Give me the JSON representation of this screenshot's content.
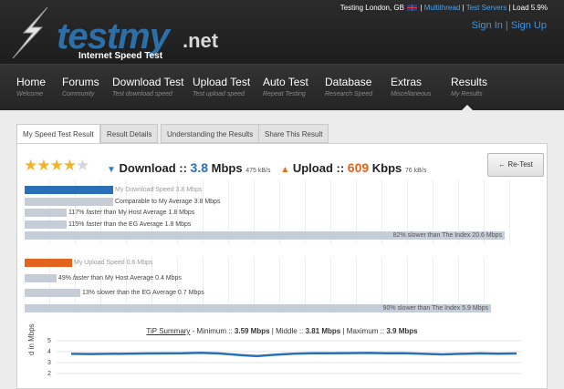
{
  "header": {
    "logo_text": "testmy",
    "logo_domain": ".net",
    "logo_subtitle": "Internet Speed Test",
    "top_status": {
      "location": "Testing London, GB",
      "link1": "Multithread",
      "link2": "Test Servers",
      "load": "Load 5.9%"
    },
    "sign_in": "Sign In",
    "sign_up": "Sign Up"
  },
  "nav": [
    {
      "label": "Home",
      "sub": "Welcome"
    },
    {
      "label": "Forums",
      "sub": "Community"
    },
    {
      "label": "Download Test",
      "sub": "Test download speed"
    },
    {
      "label": "Upload Test",
      "sub": "Test upload speed"
    },
    {
      "label": "Auto Test",
      "sub": "Repeat Testing"
    },
    {
      "label": "Database",
      "sub": "Research Speed"
    },
    {
      "label": "Extras",
      "sub": "Miscellaneous"
    },
    {
      "label": "Results",
      "sub": "My Results"
    }
  ],
  "tabs": [
    {
      "label": "My Speed Test Result"
    },
    {
      "label": "Result Details"
    },
    {
      "label": "Understanding the Results"
    },
    {
      "label": "Share This Result"
    }
  ],
  "rating": 4,
  "summary": {
    "download_label": "Download ::",
    "download_value": "3.8",
    "download_unit": "Mbps",
    "download_kb": "475 kB/s",
    "upload_label": "Upload ::",
    "upload_value": "609",
    "upload_unit": "Kbps",
    "upload_kb": "76 kB/s"
  },
  "retest_label": "← Re-Test",
  "download_bars": [
    {
      "label": "My Download Speed 3.8 Mbps",
      "pct": 18.5,
      "style": "blue"
    },
    {
      "label": "Comparable to My Average 3.8 Mbps",
      "pct": 18.5,
      "style": "gray"
    },
    {
      "label_pre": "117%",
      "label_em": "faster",
      "label_post": "than My Host Average 1.8 Mbps",
      "pct": 8.8,
      "style": "gray"
    },
    {
      "label_pre": "115%",
      "label_em": "faster",
      "label_post": "than the EG Average 1.8 Mbps",
      "pct": 8.8,
      "style": "gray"
    },
    {
      "label": "82% slower than The Index 20.6 Mbps",
      "pct": 100,
      "style": "gray",
      "align": "right"
    }
  ],
  "upload_bars": [
    {
      "label": "My Upload Speed 0.6 Mbps",
      "pct": 10.2,
      "style": "orange"
    },
    {
      "label_pre": "49%",
      "label_em": "faster",
      "label_post": "than My Host Average 0.4 Mbps",
      "pct": 6.8,
      "style": "gray"
    },
    {
      "label": "13% slower than the EG Average 0.7 Mbps",
      "pct": 11.9,
      "style": "gray"
    },
    {
      "label": "90% slower than The Index 5.9 Mbps",
      "pct": 100,
      "style": "gray",
      "align": "right"
    }
  ],
  "graph": {
    "title_link": "TiP Summary",
    "title_rest_1": " - Minimum :: ",
    "min": "3.59 Mbps",
    "title_rest_2": " | Middle :: ",
    "mid": "3.81 Mbps",
    "title_rest_3": " | Maximum :: ",
    "max": "3.9 Mbps",
    "ylabel": "d in Mbps",
    "yticks": [
      "5",
      "4",
      "3",
      "2"
    ]
  },
  "chart_data": {
    "type": "line",
    "title": "TiP Summary",
    "ylabel": "d in Mbps",
    "ylim": [
      2,
      5
    ],
    "x": [
      1,
      2,
      3,
      4,
      5,
      6,
      7,
      8,
      9,
      10,
      11,
      12,
      13,
      14,
      15,
      16,
      17,
      18,
      19,
      20,
      21,
      22,
      23,
      24,
      25
    ],
    "series": [
      {
        "values": [
          3.8,
          3.78,
          3.8,
          3.82,
          3.83,
          3.84,
          3.85,
          3.9,
          3.83,
          3.7,
          3.59,
          3.72,
          3.82,
          3.85,
          3.86,
          3.87,
          3.88,
          3.86,
          3.85,
          3.8,
          3.75,
          3.8,
          3.84,
          3.82,
          3.83
        ]
      }
    ]
  }
}
